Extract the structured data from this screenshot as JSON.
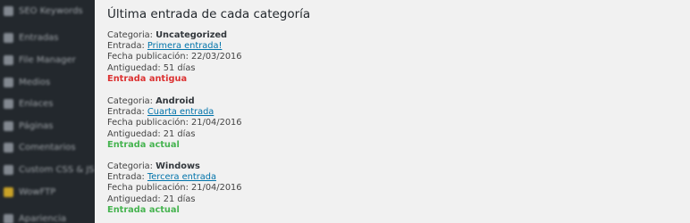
{
  "sidebar": {
    "items": [
      {
        "label": "SEO Keywords",
        "icon": "seo-icon"
      },
      {
        "label": "Entradas",
        "icon": "pin-icon"
      },
      {
        "label": "File Manager",
        "icon": "gear-icon"
      },
      {
        "label": "Medios",
        "icon": "media-icon"
      },
      {
        "label": "Enlaces",
        "icon": "link-icon"
      },
      {
        "label": "Páginas",
        "icon": "page-icon"
      },
      {
        "label": "Comentarios",
        "icon": "comment-icon"
      },
      {
        "label": "Custom CSS & JS",
        "icon": "code-icon"
      },
      {
        "label": "WowFTP",
        "icon": "folder-icon",
        "color": "#c9a227"
      },
      {
        "label": "Apariencia",
        "icon": "brush-icon"
      }
    ]
  },
  "main": {
    "title": "Última entrada de cada categoría",
    "labels": {
      "categoria": "Categoria: ",
      "entrada": "Entrada: ",
      "fecha": "Fecha publicación: ",
      "antiguedad": "Antiguedad: "
    },
    "entries": [
      {
        "category": "Uncategorized",
        "post": "Primera entrada!",
        "date": "22/03/2016",
        "age": "51 días",
        "status": "Entrada antigua",
        "status_color": "#dc3232"
      },
      {
        "category": "Android",
        "post": "Cuarta entrada",
        "date": "21/04/2016",
        "age": "21 días",
        "status": "Entrada actual",
        "status_color": "#46b450"
      },
      {
        "category": "Windows",
        "post": "Tercera entrada",
        "date": "21/04/2016",
        "age": "21 días",
        "status": "Entrada actual",
        "status_color": "#46b450"
      }
    ]
  }
}
